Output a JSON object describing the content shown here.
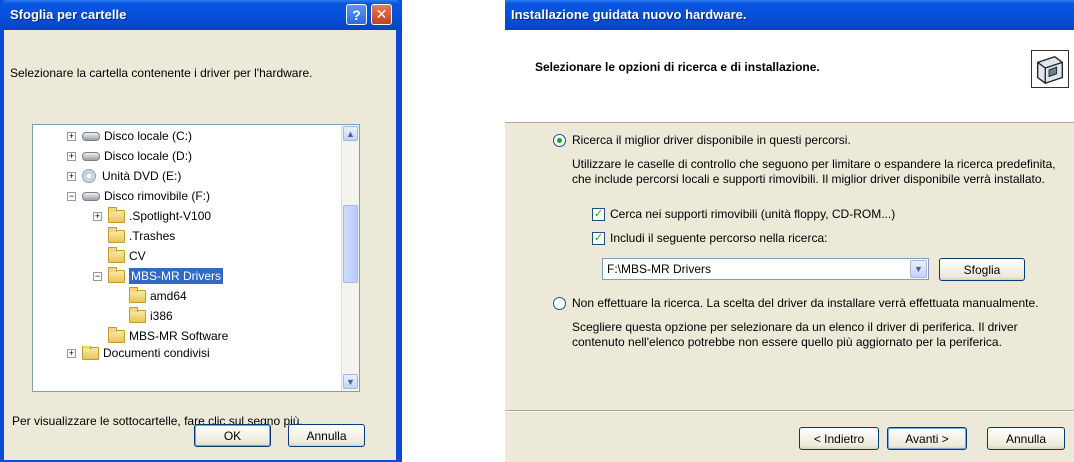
{
  "browse_dialog": {
    "title": "Sfoglia per cartelle",
    "prompt": "Selezionare la cartella contenente i driver per l'hardware.",
    "tree_items": [
      {
        "label": "Disco locale (C:)",
        "icon": "hard-drive-icon",
        "expander": "+"
      },
      {
        "label": "Disco locale (D:)",
        "icon": "hard-drive-icon",
        "expander": "+"
      },
      {
        "label": "Unità DVD (E:)",
        "icon": "dvd-drive-icon",
        "expander": "+"
      },
      {
        "label": "Disco rimovibile (F:)",
        "icon": "removable-drive-icon",
        "expander": "−"
      },
      {
        "label": ".Spotlight-V100",
        "icon": "folder-icon",
        "expander": "+"
      },
      {
        "label": ".Trashes",
        "icon": "folder-icon",
        "expander": ""
      },
      {
        "label": "CV",
        "icon": "folder-icon",
        "expander": ""
      },
      {
        "label": "MBS-MR Drivers",
        "icon": "open-folder-icon",
        "expander": "−",
        "selected": true
      },
      {
        "label": "amd64",
        "icon": "folder-icon",
        "expander": ""
      },
      {
        "label": "i386",
        "icon": "folder-icon",
        "expander": ""
      },
      {
        "label": "MBS-MR Software",
        "icon": "folder-icon",
        "expander": ""
      },
      {
        "label": "Documenti condivisi",
        "icon": "folder-icon",
        "expander": "+"
      }
    ],
    "hint": "Per visualizzare le sottocartelle, fare clic sul segno più.",
    "ok_label": "OK",
    "cancel_label": "Annulla",
    "help_glyph": "?",
    "close_glyph": "✕"
  },
  "wizard": {
    "title": "Installazione guidata nuovo hardware.",
    "heading": "Selezionare le opzioni di ricerca e di installazione.",
    "option_search_label": "Ricerca il miglior driver disponibile in questi percorsi.",
    "option_search_desc_1": "Utilizzare le caselle di controllo che seguono per limitare o espandere la ricerca predefinita,",
    "option_search_desc_2": "che include percorsi locali e supporti rimovibili. Il miglior driver disponibile verrà installato.",
    "check_removable_label": "Cerca nei supporti rimovibili (unità floppy, CD-ROM...)",
    "check_path_label": "Includi il seguente percorso nella ricerca:",
    "path_value": "F:\\MBS-MR Drivers",
    "browse_label": "Sfoglia",
    "option_manual_label": "Non effettuare la ricerca. La scelta del driver da installare verrà effettuata manualmente.",
    "option_manual_desc_1": "Scegliere questa opzione per selezionare da un elenco il driver di periferica. Il driver",
    "option_manual_desc_2": "contenuto nell'elenco potrebbe non essere quello più aggiornato per la periferica.",
    "back_label": "< Indietro",
    "next_label": "Avanti >",
    "cancel_label": "Annulla",
    "search_selected": true,
    "removable_checked": true,
    "path_checked": true
  }
}
